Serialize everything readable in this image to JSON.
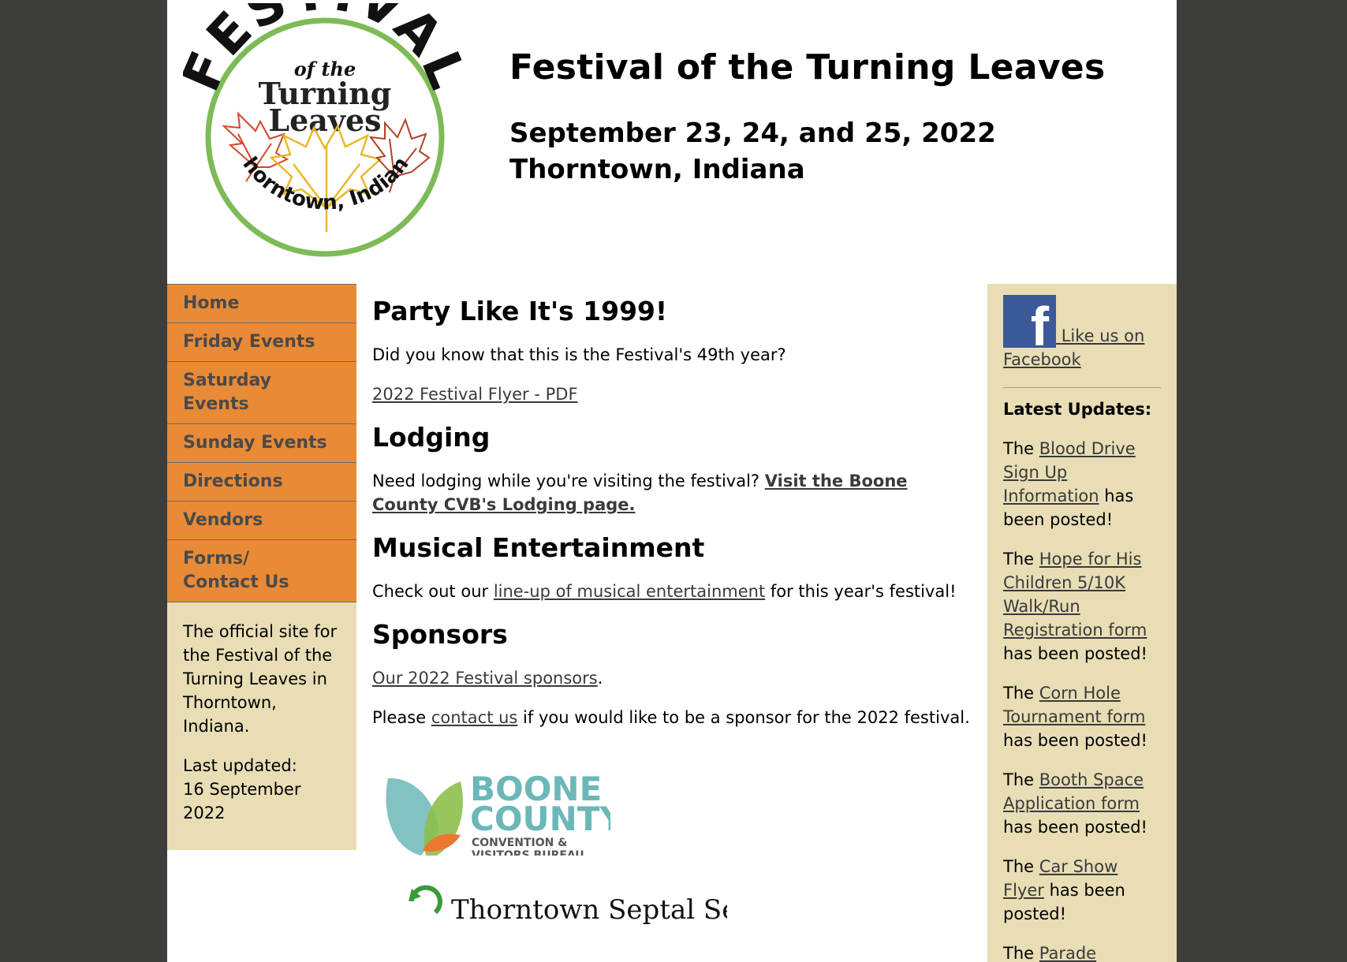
{
  "header": {
    "logo": {
      "word_top": "FESTIVAL",
      "word_of": "of the",
      "word_turning": "Turning",
      "word_leaves": "Leaves",
      "word_bottom": "Thorntown, Indiana"
    },
    "title": "Festival of the Turning Leaves",
    "dates_line1": "September 23, 24, and 25, 2022",
    "dates_line2": "Thorntown, Indiana"
  },
  "nav": {
    "items": [
      {
        "label": "Home"
      },
      {
        "label": "Friday Events"
      },
      {
        "label": "Saturday Events"
      },
      {
        "label": "Sunday Events"
      },
      {
        "label": "Directions"
      },
      {
        "label": "Vendors"
      },
      {
        "label_line1": "Forms/",
        "label_line2": "Contact Us"
      }
    ]
  },
  "left_info": {
    "about": "The official site for the Festival of the Turning Leaves in Thorntown, Indiana.",
    "updated_label": "Last updated:",
    "updated_date": "16 September 2022"
  },
  "main": {
    "heading1": "Party Like It's 1999!",
    "intro": "Did you know that this is the Festival's 49th year?",
    "flyer_link": "2022 Festival Flyer - PDF",
    "lodging_heading": "Lodging",
    "lodging_text": "Need lodging while you're visiting the festival?",
    "lodging_link": "Visit the Boone County CVB's Lodging page.",
    "music_heading": "Musical Entertainment",
    "music_pre": "Check out our",
    "music_link": "line-up of musical entertainment",
    "music_post": "for this year's festival!",
    "sponsors_heading": "Sponsors",
    "sponsors_link": "Our 2022 Festival sponsors",
    "sponsors_period": ".",
    "contact_pre": "Please",
    "contact_link": "contact us",
    "contact_post": "if you would like to be a sponsor for the 2022 festival.",
    "boone_logo": {
      "line1": "BOONE",
      "line2": "COUNTY",
      "line3": "CONVENTION &",
      "line4": "VISITORS BUREAU"
    },
    "sponsor2_partial": "Thorntown Septal Servi"
  },
  "right": {
    "facebook_link": "Like us on Facebook",
    "facebook_glyph": "f",
    "updates_title": "Latest Updates:",
    "updates": [
      {
        "pre": "The",
        "link": "Blood Drive Sign Up Information",
        "post": "has been posted!"
      },
      {
        "pre": "The",
        "link": "Hope for His Children 5/10K Walk/Run Registration form",
        "post": "has been posted!"
      },
      {
        "pre": "The",
        "link": "Corn Hole Tournament form",
        "post": "has been posted!"
      },
      {
        "pre": "The",
        "link": "Booth Space Application form",
        "post": "has been posted!"
      },
      {
        "pre": "The",
        "link": "Car Show Flyer",
        "post": "has been posted!"
      },
      {
        "pre": "The",
        "link": "Parade",
        "post": ""
      }
    ]
  },
  "colors": {
    "background": "#3d3d3b",
    "nav": "#e98a36",
    "sidebar": "#e8ddb5",
    "facebook": "#3b5998",
    "logo_ring": "#7dbb56"
  }
}
